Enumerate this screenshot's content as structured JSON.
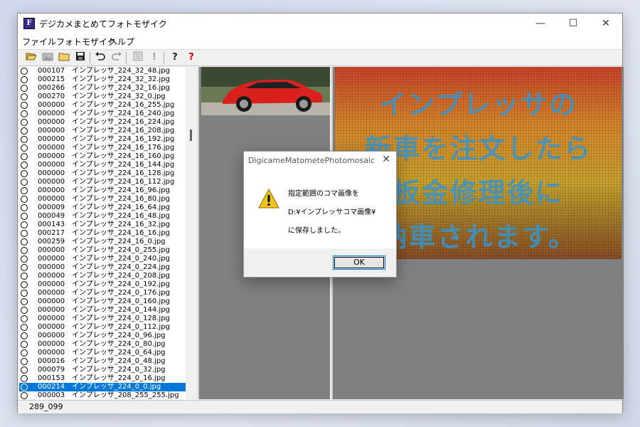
{
  "window": {
    "title": "デジカメまとめてフォトモザイク",
    "icon_letter": "F",
    "controls": {
      "minimize": "—",
      "maximize": "☐",
      "close": "✕"
    }
  },
  "menu": [
    "ファイル",
    "フォトモザイク",
    "ヘルプ"
  ],
  "toolbar_icons": [
    "folder-open-icon",
    "image-icon",
    "folder-icon",
    "save-icon",
    "undo-icon",
    "redo-icon",
    "list-icon",
    "exclamation-icon",
    "help-icon",
    "help-red-icon"
  ],
  "files": [
    {
      "num": "000107",
      "name": "インプレッサ_224_32_48.jpg"
    },
    {
      "num": "000215",
      "name": "インプレッサ_224_32_32.jpg"
    },
    {
      "num": "000266",
      "name": "インプレッサ_224_32_16.jpg"
    },
    {
      "num": "000270",
      "name": "インプレッサ_224_32_0.jpg"
    },
    {
      "num": "000000",
      "name": "インプレッサ_224_16_255.jpg"
    },
    {
      "num": "000000",
      "name": "インプレッサ_224_16_240.jpg"
    },
    {
      "num": "000000",
      "name": "インプレッサ_224_16_224.jpg"
    },
    {
      "num": "000000",
      "name": "インプレッサ_224_16_208.jpg"
    },
    {
      "num": "000000",
      "name": "インプレッサ_224_16_192.jpg"
    },
    {
      "num": "000000",
      "name": "インプレッサ_224_16_176.jpg"
    },
    {
      "num": "000000",
      "name": "インプレッサ_224_16_160.jpg"
    },
    {
      "num": "000000",
      "name": "インプレッサ_224_16_144.jpg"
    },
    {
      "num": "000000",
      "name": "インプレッサ_224_16_128.jpg"
    },
    {
      "num": "000000",
      "name": "インプレッサ_224_16_112.jpg"
    },
    {
      "num": "000000",
      "name": "インプレッサ_224_16_96.jpg"
    },
    {
      "num": "000000",
      "name": "インプレッサ_224_16_80.jpg"
    },
    {
      "num": "000009",
      "name": "インプレッサ_224_16_64.jpg"
    },
    {
      "num": "000049",
      "name": "インプレッサ_224_16_48.jpg"
    },
    {
      "num": "000143",
      "name": "インプレッサ_224_16_32.jpg"
    },
    {
      "num": "000217",
      "name": "インプレッサ_224_16_16.jpg"
    },
    {
      "num": "000259",
      "name": "インプレッサ_224_16_0.jpg"
    },
    {
      "num": "000000",
      "name": "インプレッサ_224_0_255.jpg"
    },
    {
      "num": "000000",
      "name": "インプレッサ_224_0_240.jpg"
    },
    {
      "num": "000000",
      "name": "インプレッサ_224_0_224.jpg"
    },
    {
      "num": "000000",
      "name": "インプレッサ_224_0_208.jpg"
    },
    {
      "num": "000000",
      "name": "インプレッサ_224_0_192.jpg"
    },
    {
      "num": "000000",
      "name": "インプレッサ_224_0_176.jpg"
    },
    {
      "num": "000000",
      "name": "インプレッサ_224_0_160.jpg"
    },
    {
      "num": "000000",
      "name": "インプレッサ_224_0_144.jpg"
    },
    {
      "num": "000000",
      "name": "インプレッサ_224_0_128.jpg"
    },
    {
      "num": "000000",
      "name": "インプレッサ_224_0_112.jpg"
    },
    {
      "num": "000000",
      "name": "インプレッサ_224_0_96.jpg"
    },
    {
      "num": "000000",
      "name": "インプレッサ_224_0_80.jpg"
    },
    {
      "num": "000000",
      "name": "インプレッサ_224_0_64.jpg"
    },
    {
      "num": "000016",
      "name": "インプレッサ_224_0_48.jpg"
    },
    {
      "num": "000079",
      "name": "インプレッサ_224_0_32.jpg"
    },
    {
      "num": "000153",
      "name": "インプレッサ_224_0_16.jpg"
    },
    {
      "num": "000214",
      "name": "インプレッサ_224_0_0.jpg",
      "selected": true
    },
    {
      "num": "000003",
      "name": "インプレッサ_208_255_255.jpg"
    }
  ],
  "mosaic_text": [
    "インプレッサの",
    "新車を注文したら",
    "板金修理後に",
    "納車されます。"
  ],
  "status": "289_099",
  "dialog": {
    "title": "DigicameMatometePhotomosaic",
    "close": "✕",
    "lines": [
      "指定範囲のコマ画像を",
      "D:¥インプレッサコマ画像¥",
      "に保存しました。"
    ],
    "ok": "OK"
  },
  "colors": {
    "selection": "#0078d7",
    "mosaic_text": "#3a94c9",
    "car": "#d8201c"
  }
}
